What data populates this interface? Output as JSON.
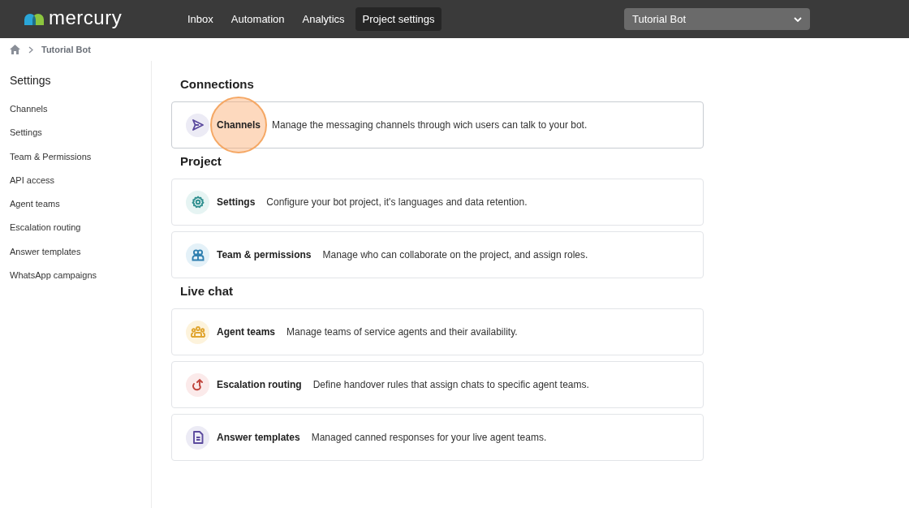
{
  "logo": {
    "text": "mercury"
  },
  "nav": [
    {
      "label": "Inbox",
      "selected": false
    },
    {
      "label": "Automation",
      "selected": false
    },
    {
      "label": "Analytics",
      "selected": false
    },
    {
      "label": "Project settings",
      "selected": true
    }
  ],
  "project_select": {
    "value": "Tutorial Bot"
  },
  "breadcrumb": [
    "Tutorial Bot"
  ],
  "sidebar": {
    "title": "Settings",
    "items": [
      "Channels",
      "Settings",
      "Team & Permissions",
      "API access",
      "Agent teams",
      "Escalation routing",
      "Answer templates",
      "WhatsApp campaigns"
    ]
  },
  "sections": [
    {
      "title": "Connections",
      "cards": [
        {
          "kind": "send",
          "color": "#5b4a9e",
          "title": "Channels",
          "description": "Manage the messaging channels through wich users can talk to your bot.",
          "clicked": true
        }
      ]
    },
    {
      "title": "Project",
      "cards": [
        {
          "kind": "gear",
          "color": "#2f8f8f",
          "title": "Settings",
          "description": "Configure your bot project, it's languages and data retention.",
          "clicked": false
        },
        {
          "kind": "people",
          "color": "#2f7fb0",
          "title": "Team & permissions",
          "description": "Manage who can collaborate on the project, and assign roles.",
          "clicked": false
        }
      ]
    },
    {
      "title": "Live chat",
      "cards": [
        {
          "kind": "group",
          "color": "#e0a530",
          "title": "Agent teams",
          "description": "Manage teams of service agents and their availability.",
          "clicked": false
        },
        {
          "kind": "escalate",
          "color": "#c0443c",
          "title": "Escalation routing",
          "description": "Define handover rules that assign chats to specific agent teams.",
          "clicked": false
        },
        {
          "kind": "document",
          "color": "#5b4a9e",
          "title": "Answer templates",
          "description": "Managed canned responses for your live agent teams.",
          "clicked": false
        }
      ]
    }
  ]
}
